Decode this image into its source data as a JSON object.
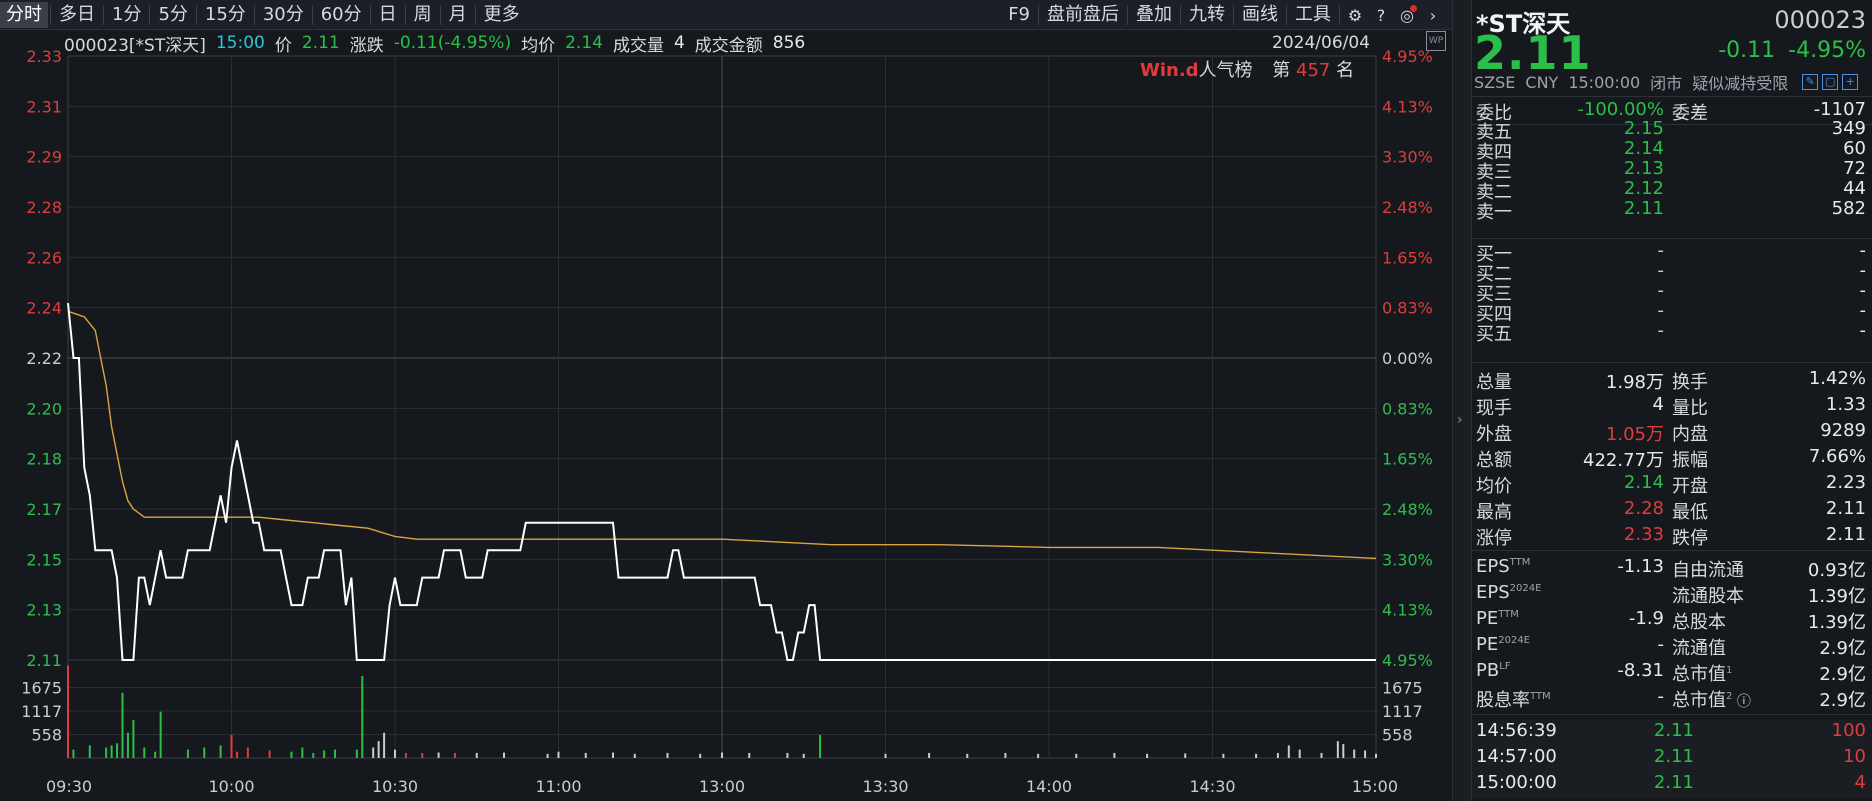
{
  "toolbar": {
    "periods": [
      "分时",
      "多日",
      "1分",
      "5分",
      "15分",
      "30分",
      "60分",
      "日",
      "周",
      "月",
      "更多"
    ],
    "active_period": "分时",
    "tools": [
      "F9",
      "盘前盘后",
      "叠加",
      "九转",
      "画线",
      "工具"
    ],
    "icons": [
      "gear-icon",
      "help-icon",
      "notification-icon",
      "chevron-right-icon"
    ]
  },
  "infobar": {
    "code_name": "000023[*ST深天]",
    "time": "15:00",
    "price_label": "价",
    "price": "2.11",
    "change_label": "涨跌",
    "change": "-0.11(-4.95%)",
    "avg_label": "均价",
    "avg": "2.14",
    "volume_label": "成交量",
    "volume": "4",
    "amount_label": "成交金额",
    "amount": "856",
    "date": "2024/06/04",
    "badge": "WP"
  },
  "popularity": {
    "brand": "Win.d",
    "label": "人气榜",
    "rank_prefix": "第",
    "rank": "457",
    "rank_suffix": "名"
  },
  "chart_data": {
    "type": "line",
    "title": "",
    "prev_close": 2.22,
    "price_ylim": [
      2.11,
      2.33
    ],
    "price_ticks": [
      "2.33",
      "2.31",
      "2.29",
      "2.28",
      "2.26",
      "2.24",
      "2.22",
      "2.20",
      "2.18",
      "2.17",
      "2.15",
      "2.13",
      "2.11"
    ],
    "pct_ticks": [
      "4.95%",
      "4.13%",
      "3.30%",
      "2.48%",
      "1.65%",
      "0.83%",
      "0.00%",
      "0.83%",
      "1.65%",
      "2.48%",
      "3.30%",
      "4.13%",
      "4.95%"
    ],
    "volume_ticks": [
      "1675",
      "1117",
      "558"
    ],
    "volume_ylim": [
      0,
      2234
    ],
    "x_ticks": [
      "09:30",
      "10:00",
      "10:30",
      "11:00",
      "13:00",
      "13:30",
      "14:00",
      "14:30",
      "15:00"
    ],
    "total_minutes": 240,
    "colors": {
      "price": "#ffffff",
      "avg": "#d9a441",
      "up": "#e03c3c",
      "down": "#2bbf4a",
      "grid": "#2a2e35",
      "axis": "#3a3f48",
      "pos": "#e03c3c",
      "neg": "#2bbf4a",
      "neutral": "#c9ccd1"
    },
    "series": [
      {
        "name": "价",
        "points": [
          [
            0,
            2.24
          ],
          [
            1,
            2.22
          ],
          [
            2,
            2.22
          ],
          [
            3,
            2.18
          ],
          [
            4,
            2.17
          ],
          [
            5,
            2.15
          ],
          [
            6,
            2.15
          ],
          [
            7,
            2.15
          ],
          [
            8,
            2.15
          ],
          [
            9,
            2.14
          ],
          [
            10,
            2.11
          ],
          [
            11,
            2.11
          ],
          [
            12,
            2.11
          ],
          [
            13,
            2.14
          ],
          [
            14,
            2.14
          ],
          [
            15,
            2.13
          ],
          [
            16,
            2.14
          ],
          [
            17,
            2.15
          ],
          [
            18,
            2.14
          ],
          [
            19,
            2.14
          ],
          [
            20,
            2.14
          ],
          [
            21,
            2.14
          ],
          [
            22,
            2.15
          ],
          [
            23,
            2.15
          ],
          [
            24,
            2.15
          ],
          [
            25,
            2.15
          ],
          [
            26,
            2.15
          ],
          [
            27,
            2.16
          ],
          [
            28,
            2.17
          ],
          [
            29,
            2.16
          ],
          [
            30,
            2.18
          ],
          [
            31,
            2.19
          ],
          [
            32,
            2.18
          ],
          [
            33,
            2.17
          ],
          [
            34,
            2.16
          ],
          [
            35,
            2.16
          ],
          [
            36,
            2.15
          ],
          [
            37,
            2.15
          ],
          [
            38,
            2.15
          ],
          [
            39,
            2.15
          ],
          [
            40,
            2.14
          ],
          [
            41,
            2.13
          ],
          [
            42,
            2.13
          ],
          [
            43,
            2.13
          ],
          [
            44,
            2.14
          ],
          [
            45,
            2.14
          ],
          [
            46,
            2.14
          ],
          [
            47,
            2.15
          ],
          [
            48,
            2.15
          ],
          [
            49,
            2.15
          ],
          [
            50,
            2.15
          ],
          [
            51,
            2.13
          ],
          [
            52,
            2.14
          ],
          [
            53,
            2.11
          ],
          [
            54,
            2.11
          ],
          [
            55,
            2.11
          ],
          [
            56,
            2.11
          ],
          [
            57,
            2.11
          ],
          [
            58,
            2.11
          ],
          [
            59,
            2.13
          ],
          [
            60,
            2.14
          ],
          [
            61,
            2.13
          ],
          [
            62,
            2.13
          ],
          [
            63,
            2.13
          ],
          [
            64,
            2.13
          ],
          [
            65,
            2.14
          ],
          [
            66,
            2.14
          ],
          [
            67,
            2.14
          ],
          [
            68,
            2.14
          ],
          [
            69,
            2.15
          ],
          [
            70,
            2.15
          ],
          [
            71,
            2.15
          ],
          [
            72,
            2.15
          ],
          [
            73,
            2.14
          ],
          [
            74,
            2.14
          ],
          [
            75,
            2.14
          ],
          [
            76,
            2.14
          ],
          [
            77,
            2.15
          ],
          [
            78,
            2.15
          ],
          [
            79,
            2.15
          ],
          [
            80,
            2.15
          ],
          [
            81,
            2.15
          ],
          [
            82,
            2.15
          ],
          [
            83,
            2.15
          ],
          [
            84,
            2.16
          ],
          [
            85,
            2.16
          ],
          [
            90,
            2.16
          ],
          [
            95,
            2.16
          ],
          [
            100,
            2.16
          ],
          [
            101,
            2.14
          ],
          [
            105,
            2.14
          ],
          [
            110,
            2.14
          ],
          [
            111,
            2.15
          ],
          [
            112,
            2.15
          ],
          [
            113,
            2.14
          ],
          [
            120,
            2.14
          ],
          [
            126,
            2.14
          ],
          [
            127,
            2.13
          ],
          [
            128,
            2.13
          ],
          [
            129,
            2.13
          ],
          [
            130,
            2.12
          ],
          [
            131,
            2.12
          ],
          [
            132,
            2.11
          ],
          [
            133,
            2.11
          ],
          [
            134,
            2.12
          ],
          [
            135,
            2.12
          ],
          [
            136,
            2.13
          ],
          [
            137,
            2.13
          ],
          [
            138,
            2.11
          ],
          [
            140,
            2.11
          ],
          [
            160,
            2.11
          ],
          [
            180,
            2.11
          ],
          [
            200,
            2.11
          ],
          [
            220,
            2.11
          ],
          [
            240,
            2.11
          ]
        ]
      },
      {
        "name": "均价",
        "points": [
          [
            0,
            2.237
          ],
          [
            3,
            2.235
          ],
          [
            5,
            2.23
          ],
          [
            6,
            2.22
          ],
          [
            7,
            2.21
          ],
          [
            8,
            2.195
          ],
          [
            9,
            2.185
          ],
          [
            10,
            2.175
          ],
          [
            11,
            2.168
          ],
          [
            12,
            2.165
          ],
          [
            14,
            2.162
          ],
          [
            16,
            2.162
          ],
          [
            20,
            2.162
          ],
          [
            25,
            2.162
          ],
          [
            30,
            2.162
          ],
          [
            35,
            2.162
          ],
          [
            40,
            2.161
          ],
          [
            45,
            2.16
          ],
          [
            50,
            2.159
          ],
          [
            55,
            2.158
          ],
          [
            60,
            2.155
          ],
          [
            64,
            2.154
          ],
          [
            70,
            2.154
          ],
          [
            80,
            2.154
          ],
          [
            90,
            2.154
          ],
          [
            100,
            2.154
          ],
          [
            110,
            2.154
          ],
          [
            120,
            2.154
          ],
          [
            130,
            2.153
          ],
          [
            140,
            2.152
          ],
          [
            160,
            2.152
          ],
          [
            180,
            2.151
          ],
          [
            200,
            2.151
          ],
          [
            210,
            2.15
          ],
          [
            220,
            2.149
          ],
          [
            230,
            2.148
          ],
          [
            240,
            2.147
          ]
        ]
      }
    ],
    "volumes": [
      [
        0,
        2200,
        "up"
      ],
      [
        1,
        200,
        "down"
      ],
      [
        4,
        300,
        "down"
      ],
      [
        7,
        250,
        "down"
      ],
      [
        8,
        300,
        "down"
      ],
      [
        9,
        350,
        "down"
      ],
      [
        10,
        1550,
        "down"
      ],
      [
        11,
        600,
        "down"
      ],
      [
        12,
        900,
        "down"
      ],
      [
        14,
        250,
        "down"
      ],
      [
        16,
        150,
        "down"
      ],
      [
        17,
        1100,
        "down"
      ],
      [
        22,
        200,
        "down"
      ],
      [
        25,
        250,
        "down"
      ],
      [
        28,
        300,
        "down"
      ],
      [
        30,
        550,
        "up"
      ],
      [
        31,
        150,
        "up"
      ],
      [
        33,
        250,
        "up"
      ],
      [
        37,
        180,
        "up"
      ],
      [
        41,
        150,
        "down"
      ],
      [
        43,
        250,
        "down"
      ],
      [
        45,
        120,
        "down"
      ],
      [
        47,
        180,
        "down"
      ],
      [
        49,
        200,
        "down"
      ],
      [
        53,
        200,
        "down"
      ],
      [
        54,
        1950,
        "down"
      ],
      [
        56,
        250,
        "neutral"
      ],
      [
        57,
        400,
        "neutral"
      ],
      [
        58,
        600,
        "neutral"
      ],
      [
        60,
        200,
        "neutral"
      ],
      [
        62,
        120,
        "up"
      ],
      [
        65,
        120,
        "up"
      ],
      [
        68,
        130,
        "neutral"
      ],
      [
        71,
        120,
        "up"
      ],
      [
        75,
        120,
        "neutral"
      ],
      [
        80,
        130,
        "neutral"
      ],
      [
        88,
        100,
        "neutral"
      ],
      [
        90,
        150,
        "neutral"
      ],
      [
        95,
        120,
        "neutral"
      ],
      [
        100,
        130,
        "neutral"
      ],
      [
        104,
        100,
        "neutral"
      ],
      [
        110,
        120,
        "neutral"
      ],
      [
        116,
        100,
        "neutral"
      ],
      [
        120,
        130,
        "neutral"
      ],
      [
        125,
        120,
        "neutral"
      ],
      [
        132,
        120,
        "neutral"
      ],
      [
        135,
        100,
        "neutral"
      ],
      [
        138,
        550,
        "down"
      ],
      [
        150,
        100,
        "neutral"
      ],
      [
        158,
        120,
        "neutral"
      ],
      [
        165,
        100,
        "neutral"
      ],
      [
        172,
        120,
        "neutral"
      ],
      [
        178,
        100,
        "neutral"
      ],
      [
        185,
        100,
        "neutral"
      ],
      [
        192,
        120,
        "neutral"
      ],
      [
        198,
        100,
        "neutral"
      ],
      [
        205,
        110,
        "neutral"
      ],
      [
        212,
        100,
        "neutral"
      ],
      [
        218,
        100,
        "neutral"
      ],
      [
        222,
        120,
        "neutral"
      ],
      [
        224,
        300,
        "neutral"
      ],
      [
        226,
        200,
        "neutral"
      ],
      [
        230,
        120,
        "neutral"
      ],
      [
        233,
        400,
        "neutral"
      ],
      [
        234,
        330,
        "neutral"
      ],
      [
        236,
        200,
        "neutral"
      ],
      [
        238,
        180,
        "neutral"
      ],
      [
        240,
        100,
        "neutral"
      ]
    ]
  },
  "panel": {
    "name": "*ST深天",
    "code": "000023",
    "price": "2.11",
    "change": "-0.11",
    "change_pct": "-4.95%",
    "meta": [
      "SZSE",
      "CNY",
      "15:00:00",
      "闭市",
      "疑似减持受限"
    ],
    "weibi": {
      "label": "委比",
      "value": "-100.00%",
      "label2": "委差",
      "value2": "-1107"
    },
    "asks": [
      {
        "label": "卖五",
        "price": "2.15",
        "vol": "349"
      },
      {
        "label": "卖四",
        "price": "2.14",
        "vol": "60"
      },
      {
        "label": "卖三",
        "price": "2.13",
        "vol": "72"
      },
      {
        "label": "卖二",
        "price": "2.12",
        "vol": "44"
      },
      {
        "label": "卖一",
        "price": "2.11",
        "vol": "582"
      }
    ],
    "bids": [
      {
        "label": "买一",
        "price": "-",
        "vol": "-"
      },
      {
        "label": "买二",
        "price": "-",
        "vol": "-"
      },
      {
        "label": "买三",
        "price": "-",
        "vol": "-"
      },
      {
        "label": "买四",
        "price": "-",
        "vol": "-"
      },
      {
        "label": "买五",
        "price": "-",
        "vol": "-"
      }
    ],
    "stats": [
      {
        "l": "总量",
        "v": "1.98万",
        "vc": "w",
        "l2": "换手",
        "v2": "1.42%",
        "v2c": "w"
      },
      {
        "l": "现手",
        "v": "4",
        "vc": "w",
        "l2": "量比",
        "v2": "1.33",
        "v2c": "w"
      },
      {
        "l": "外盘",
        "v": "1.05万",
        "vc": "r",
        "l2": "内盘",
        "v2": "9289",
        "v2c": "g"
      },
      {
        "l": "总额",
        "v": "422.77万",
        "vc": "w",
        "l2": "振幅",
        "v2": "7.66%",
        "v2c": "w"
      },
      {
        "l": "均价",
        "v": "2.14",
        "vc": "g",
        "l2": "开盘",
        "v2": "2.23",
        "v2c": "r"
      },
      {
        "l": "最高",
        "v": "2.28",
        "vc": "r",
        "l2": "最低",
        "v2": "2.11",
        "v2c": "g"
      },
      {
        "l": "涨停",
        "v": "2.33",
        "vc": "r",
        "l2": "跌停",
        "v2": "2.11",
        "v2c": "g"
      }
    ],
    "fundamentals": [
      {
        "l": "EPS",
        "sup": "TTM",
        "v": "-1.13",
        "l2": "自由流通",
        "v2": "0.93亿"
      },
      {
        "l": "EPS",
        "sup": "2024E",
        "v": "",
        "l2": "流通股本",
        "v2": "1.39亿"
      },
      {
        "l": "PE",
        "sup": "TTM",
        "v": "-1.9",
        "l2": "总股本",
        "v2": "1.39亿"
      },
      {
        "l": "PE",
        "sup": "2024E",
        "v": "-",
        "l2": "流通值",
        "v2": "2.9亿"
      },
      {
        "l": "PB",
        "sup": "LF",
        "v": "-8.31",
        "l2": "总市值",
        "sup2": "1",
        "v2": "2.9亿"
      },
      {
        "l": "股息率",
        "sup": "TTM",
        "v": "-",
        "l2": "总市值",
        "sup2": "2",
        "v2": "2.9亿"
      }
    ],
    "ticks": [
      {
        "time": "14:56:39",
        "price": "2.11",
        "vol": "100"
      },
      {
        "time": "14:57:00",
        "price": "2.11",
        "vol": "10"
      },
      {
        "time": "15:00:00",
        "price": "2.11",
        "vol": "4"
      }
    ]
  }
}
